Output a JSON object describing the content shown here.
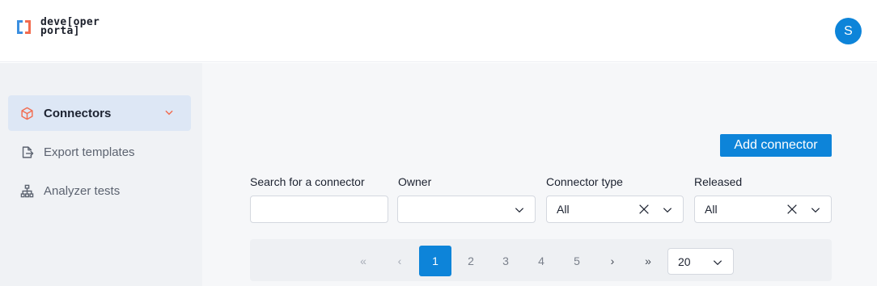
{
  "brand": {
    "line1": "deve[oper",
    "line2": "porta]"
  },
  "user": {
    "avatar_initial": "S"
  },
  "sidebar": {
    "items": [
      {
        "label": "Connectors",
        "icon": "cube-icon",
        "active": true
      },
      {
        "label": "Export templates",
        "icon": "export-icon",
        "active": false
      },
      {
        "label": "Analyzer tests",
        "icon": "sitemap-icon",
        "active": false
      }
    ]
  },
  "toolbar": {
    "add_label": "Add connector"
  },
  "filters": {
    "search": {
      "label": "Search for a connector",
      "value": ""
    },
    "owner": {
      "label": "Owner",
      "value": ""
    },
    "connector_type": {
      "label": "Connector type",
      "value": "All"
    },
    "released": {
      "label": "Released",
      "value": "All"
    }
  },
  "pagination": {
    "first": "«",
    "prev": "‹",
    "pages": [
      "1",
      "2",
      "3",
      "4",
      "5"
    ],
    "current": "1",
    "next": "›",
    "last": "»",
    "page_size": "20"
  },
  "colors": {
    "accent": "#0d84d9",
    "brand_left": "#3b8fe0",
    "brand_right": "#f26c4f"
  }
}
